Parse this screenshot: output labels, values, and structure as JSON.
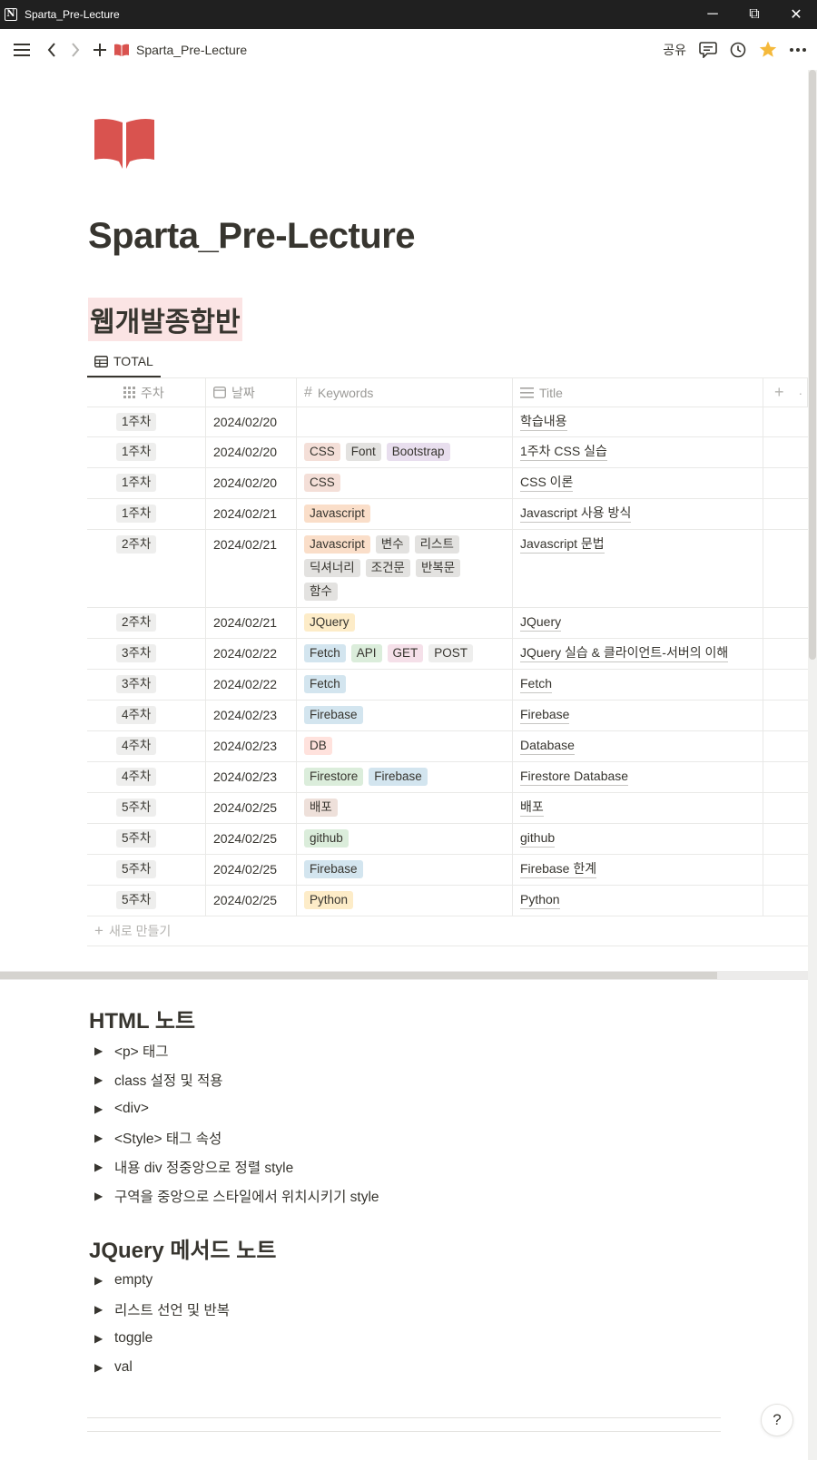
{
  "window": {
    "title": "Sparta_Pre-Lecture",
    "controls": {
      "minimize": "─",
      "restore": "⧉",
      "close": "✕"
    }
  },
  "topbar": {
    "breadcrumb": "Sparta_Pre-Lecture",
    "share_label": "공유"
  },
  "page": {
    "title": "Sparta_Pre-Lecture",
    "section_heading": "웹개발종합반",
    "view_tab": "TOTAL",
    "accent_color": "#d9534f"
  },
  "table": {
    "columns": [
      {
        "label": "주차",
        "icon": "grid-icon"
      },
      {
        "label": "날짜",
        "icon": "calendar-icon"
      },
      {
        "label": "Keywords",
        "icon": "hash-icon"
      },
      {
        "label": "Title",
        "icon": "lines-icon"
      }
    ],
    "rows": [
      {
        "week": "1주차",
        "date": "2024/02/20",
        "tags": [],
        "title": "학습내용"
      },
      {
        "week": "1주차",
        "date": "2024/02/20",
        "tags": [
          {
            "text": "CSS",
            "color": "#f4dfd8"
          },
          {
            "text": "Font",
            "color": "#e3e2e0"
          },
          {
            "text": "Bootstrap",
            "color": "#e8deee"
          }
        ],
        "title": "1주차 CSS 실습"
      },
      {
        "week": "1주차",
        "date": "2024/02/20",
        "tags": [
          {
            "text": "CSS",
            "color": "#f4dfd8"
          }
        ],
        "title": "CSS 이론"
      },
      {
        "week": "1주차",
        "date": "2024/02/21",
        "tags": [
          {
            "text": "Javascript",
            "color": "#fadec9"
          }
        ],
        "title": "Javascript 사용 방식"
      },
      {
        "week": "2주차",
        "date": "2024/02/21",
        "tags": [
          {
            "text": "Javascript",
            "color": "#fadec9"
          },
          {
            "text": "변수",
            "color": "#e3e2e0"
          },
          {
            "text": "리스트",
            "color": "#e3e2e0"
          },
          {
            "text": "딕셔너리",
            "color": "#e3e2e0"
          },
          {
            "text": "조건문",
            "color": "#e3e2e0"
          },
          {
            "text": "반복문",
            "color": "#e3e2e0"
          },
          {
            "text": "함수",
            "color": "#e3e2e0"
          }
        ],
        "title": "Javascript 문법"
      },
      {
        "week": "2주차",
        "date": "2024/02/21",
        "tags": [
          {
            "text": "JQuery",
            "color": "#fdecc8"
          }
        ],
        "title": "JQuery"
      },
      {
        "week": "3주차",
        "date": "2024/02/22",
        "tags": [
          {
            "text": "Fetch",
            "color": "#d3e5ef"
          },
          {
            "text": "API",
            "color": "#dbeddb"
          },
          {
            "text": "GET",
            "color": "#f5e0e9"
          },
          {
            "text": "POST",
            "color": "#eeeeed"
          }
        ],
        "title": "JQuery 실습 & 클라이언트-서버의 이해"
      },
      {
        "week": "3주차",
        "date": "2024/02/22",
        "tags": [
          {
            "text": "Fetch",
            "color": "#d3e5ef"
          }
        ],
        "title": "Fetch"
      },
      {
        "week": "4주차",
        "date": "2024/02/23",
        "tags": [
          {
            "text": "Firebase",
            "color": "#d3e5ef"
          }
        ],
        "title": "Firebase"
      },
      {
        "week": "4주차",
        "date": "2024/02/23",
        "tags": [
          {
            "text": "DB",
            "color": "#ffe2dd"
          }
        ],
        "title": "Database"
      },
      {
        "week": "4주차",
        "date": "2024/02/23",
        "tags": [
          {
            "text": "Firestore",
            "color": "#dbeddb"
          },
          {
            "text": "Firebase",
            "color": "#d3e5ef"
          }
        ],
        "title": "Firestore Database"
      },
      {
        "week": "5주차",
        "date": "2024/02/25",
        "tags": [
          {
            "text": "배포",
            "color": "#eee0da"
          }
        ],
        "title": "배포"
      },
      {
        "week": "5주차",
        "date": "2024/02/25",
        "tags": [
          {
            "text": "github",
            "color": "#dbeddb"
          }
        ],
        "title": "github"
      },
      {
        "week": "5주차",
        "date": "2024/02/25",
        "tags": [
          {
            "text": "Firebase",
            "color": "#d3e5ef"
          }
        ],
        "title": "Firebase 한계"
      },
      {
        "week": "5주차",
        "date": "2024/02/25",
        "tags": [
          {
            "text": "Python",
            "color": "#fdecc8"
          }
        ],
        "title": "Python"
      }
    ],
    "new_label": "새로 만들기"
  },
  "html_notes": {
    "heading": "HTML 노트",
    "items": [
      "<p> 태그",
      "class 설정 및 적용",
      "<div>",
      "<Style> 태그 속성",
      "내용 div 정중앙으로 정렬 style",
      "구역을 중앙으로 스타일에서 위치시키기 style"
    ]
  },
  "jquery_notes": {
    "heading": "JQuery 메서드 노트",
    "items": [
      "empty",
      "리스트 선언 및 반복",
      "toggle",
      "val"
    ]
  },
  "help": {
    "label": "?"
  }
}
